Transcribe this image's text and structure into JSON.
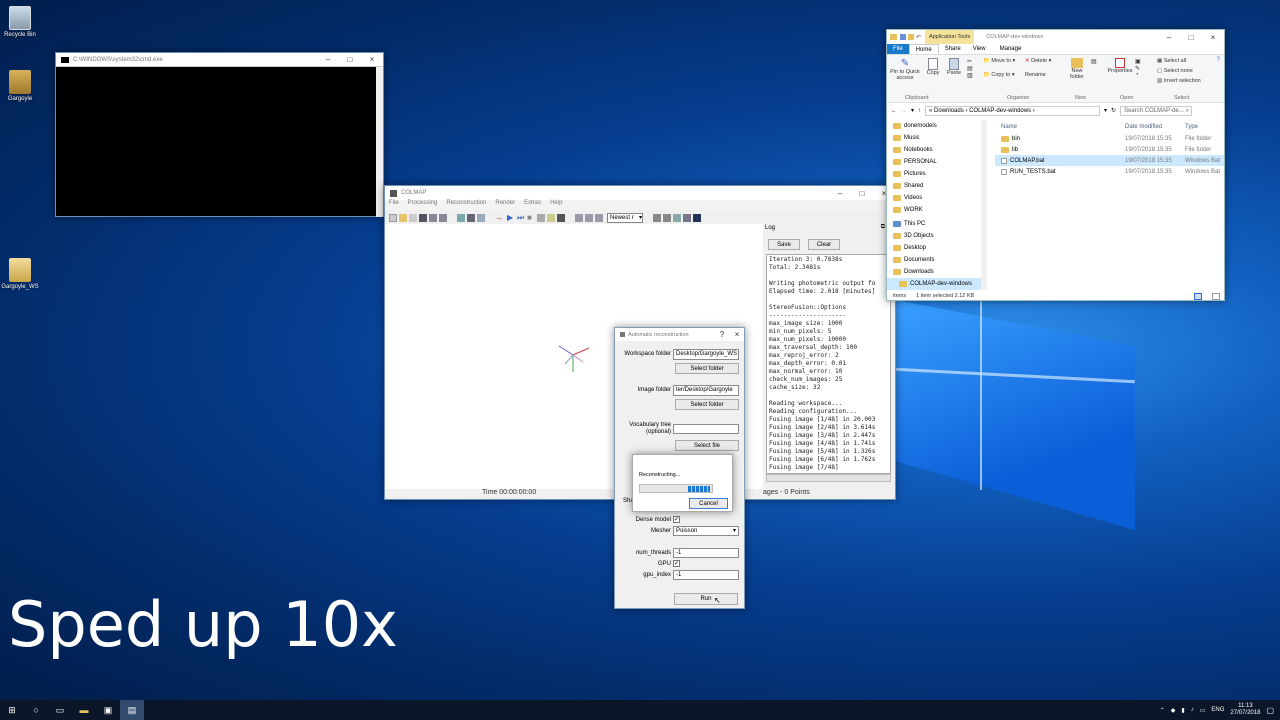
{
  "desktop": {
    "icons": [
      {
        "label": "Recycle Bin"
      },
      {
        "label": "Gargoyle"
      },
      {
        "label": "Gargoyle_WS"
      }
    ],
    "overlay_text": "Sped up 10x"
  },
  "cmd": {
    "title": "C:\\WINDOWS\\system32\\cmd.exe"
  },
  "colmap": {
    "title": "COLMAP",
    "menu": [
      "File",
      "Processing",
      "Reconstruction",
      "Render",
      "Extras",
      "Help"
    ],
    "toolbar_select": "Newest r",
    "status_time": "Time 00:00:00:00",
    "status_images": "ages - 0 Points",
    "log": {
      "title": "Log",
      "save": "Save",
      "clear": "Clear",
      "lines": [
        "Iteration 3: 0.7838s",
        "Total: 2.3481s",
        "",
        "Writing photometric output fo",
        "Elapsed time: 2.018 [minutes]",
        "",
        "StereoFusion::Options",
        "---------------------",
        "max_image_size: 1000",
        "min_num_pixels: 5",
        "max_num_pixels: 10000",
        "max_traversal_depth: 100",
        "max_reproj_error: 2",
        "max_depth_error: 0.01",
        "max_normal_error: 10",
        "check_num_images: 25",
        "cache_size: 32",
        "",
        "Reading workspace...",
        "Reading configuration...",
        "Fusing image [1/48] in 20.003",
        "Fusing image [2/48] in 3.614s",
        "Fusing image [3/48] in 2.447s",
        "Fusing image [4/48] in 1.741s",
        "Fusing image [5/48] in 1.326s",
        "Fusing image [6/48] in 1.762s",
        "Fusing image [7/48]"
      ]
    }
  },
  "auto": {
    "title": "Automatic reconstruction",
    "help": "?",
    "workspace_label": "Workspace folder",
    "workspace_value": "Desktop/Gargoyle_WS",
    "select_folder": "Select folder",
    "image_label": "Image folder",
    "image_value": "ter/Desktop/Gargoyle",
    "vocab_label": "Vocabulary tree",
    "vocab_optional": "(optional)",
    "select_file": "Select file",
    "shared_label": "Sha",
    "dense_label": "Dense model",
    "mesher_label": "Mesher",
    "mesher_value": "Poisson",
    "threads_label": "num_threads",
    "threads_value": "-1",
    "gpu_label": "GPU",
    "gpu_index_label": "gpu_index",
    "gpu_index_value": "-1",
    "run": "Run"
  },
  "progress": {
    "text": "Reconstructing...",
    "cancel": "Cancel",
    "fraction": 0.3
  },
  "explorer": {
    "title": "COLMAP-dev-windows",
    "app_tools": "Application Tools",
    "tabs": [
      "File",
      "Home",
      "Share",
      "View",
      "Manage"
    ],
    "ribbon": {
      "pin": "Pin to Quick access",
      "copy": "Copy",
      "paste": "Paste",
      "move_to": "Move to",
      "delete": "Delete",
      "copy_to": "Copy to",
      "rename": "Rename",
      "new_folder": "New folder",
      "properties": "Properties",
      "select_all": "Select all",
      "select_none": "Select none",
      "invert": "Invert selection",
      "groups": [
        "Clipboard",
        "Organise",
        "New",
        "Open",
        "Select"
      ]
    },
    "path": [
      "Downloads",
      "COLMAP-dev-windows"
    ],
    "search_placeholder": "Search COLMAP-de...",
    "nav": [
      "donemodels",
      "Music",
      "Notebooks",
      "PERSONAL",
      "Pictures",
      "Shared",
      "Videos",
      "WORK",
      "This PC",
      "3D Objects",
      "Desktop",
      "Documents",
      "Downloads",
      "COLMAP-dev-windows"
    ],
    "columns": [
      "Name",
      "Date modified",
      "Type"
    ],
    "files": [
      {
        "name": "bin",
        "date": "19/07/2018 15:35",
        "type": "File folder"
      },
      {
        "name": "lib",
        "date": "19/07/2018 15:35",
        "type": "File folder"
      },
      {
        "name": "COLMAP.bat",
        "date": "19/07/2018 15:35",
        "type": "Windows Bat"
      },
      {
        "name": "RUN_TESTS.bat",
        "date": "19/07/2018 15:35",
        "type": "Windows Bat"
      }
    ],
    "status_items": "items",
    "status_selected": "1 item selected  2.12 KB"
  },
  "taskbar": {
    "lang": "ENG",
    "time": "11:13",
    "date": "27/07/2018"
  }
}
